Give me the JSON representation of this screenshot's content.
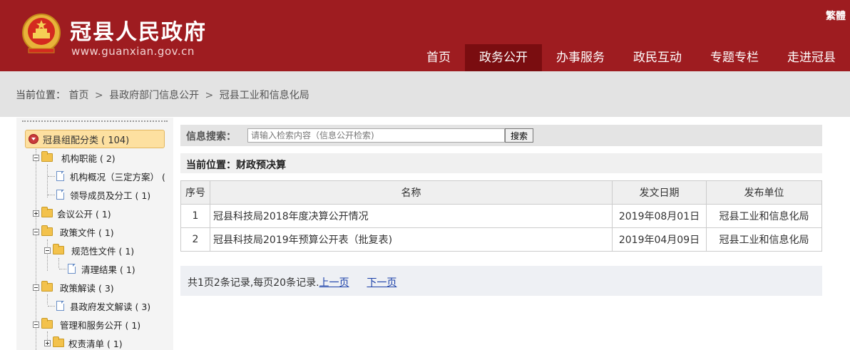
{
  "header": {
    "site_title": "冠县人民政府",
    "site_url": "www.guanxian.gov.cn",
    "lang_toggle": "繁體",
    "nav": [
      {
        "label": "首页",
        "active": false
      },
      {
        "label": "政务公开",
        "active": true
      },
      {
        "label": "办事服务",
        "active": false
      },
      {
        "label": "政民互动",
        "active": false
      },
      {
        "label": "专题专栏",
        "active": false
      },
      {
        "label": "走进冠县",
        "active": false
      }
    ]
  },
  "breadcrumb": {
    "prefix": "当前位置：",
    "items": [
      "首页",
      "县政府部门信息公开",
      "冠县工业和信息化局"
    ]
  },
  "tree": {
    "root": "冠县组配分类 ( 104)",
    "items": [
      "机构职能 ( 2)",
      "机构概况（三定方案） (",
      "领导成员及分工 ( 1)",
      "会议公开 ( 1)",
      "政策文件 ( 1)",
      "规范性文件 ( 1)",
      "清理结果 ( 1)",
      "政策解读 ( 3)",
      "县政府发文解读 ( 3)",
      "管理和服务公开 ( 1)",
      "权责清单 ( 1)"
    ]
  },
  "search": {
    "label": "信息搜索：",
    "placeholder": "请输入检索内容（信息公开检索)",
    "button": "搜索"
  },
  "location": "当前位置：财政预决算",
  "table": {
    "headers": [
      "序号",
      "名称",
      "发文日期",
      "发布单位"
    ],
    "rows": [
      {
        "no": "1",
        "name": "冠县科技局2018年度决算公开情况",
        "date": "2019年08月01日",
        "unit": "冠县工业和信息化局"
      },
      {
        "no": "2",
        "name": "冠县科技局2019年预算公开表（批复表)",
        "date": "2019年04月09日",
        "unit": "冠县工业和信息化局"
      }
    ]
  },
  "pager": {
    "summary": "共1页2条记录,每页20条记录.",
    "prev": "上一页",
    "next": "下一页"
  },
  "colors": {
    "header_bg": "#9e1c20",
    "nav_active": "#7a0d10",
    "link": "#1a3fa8"
  }
}
